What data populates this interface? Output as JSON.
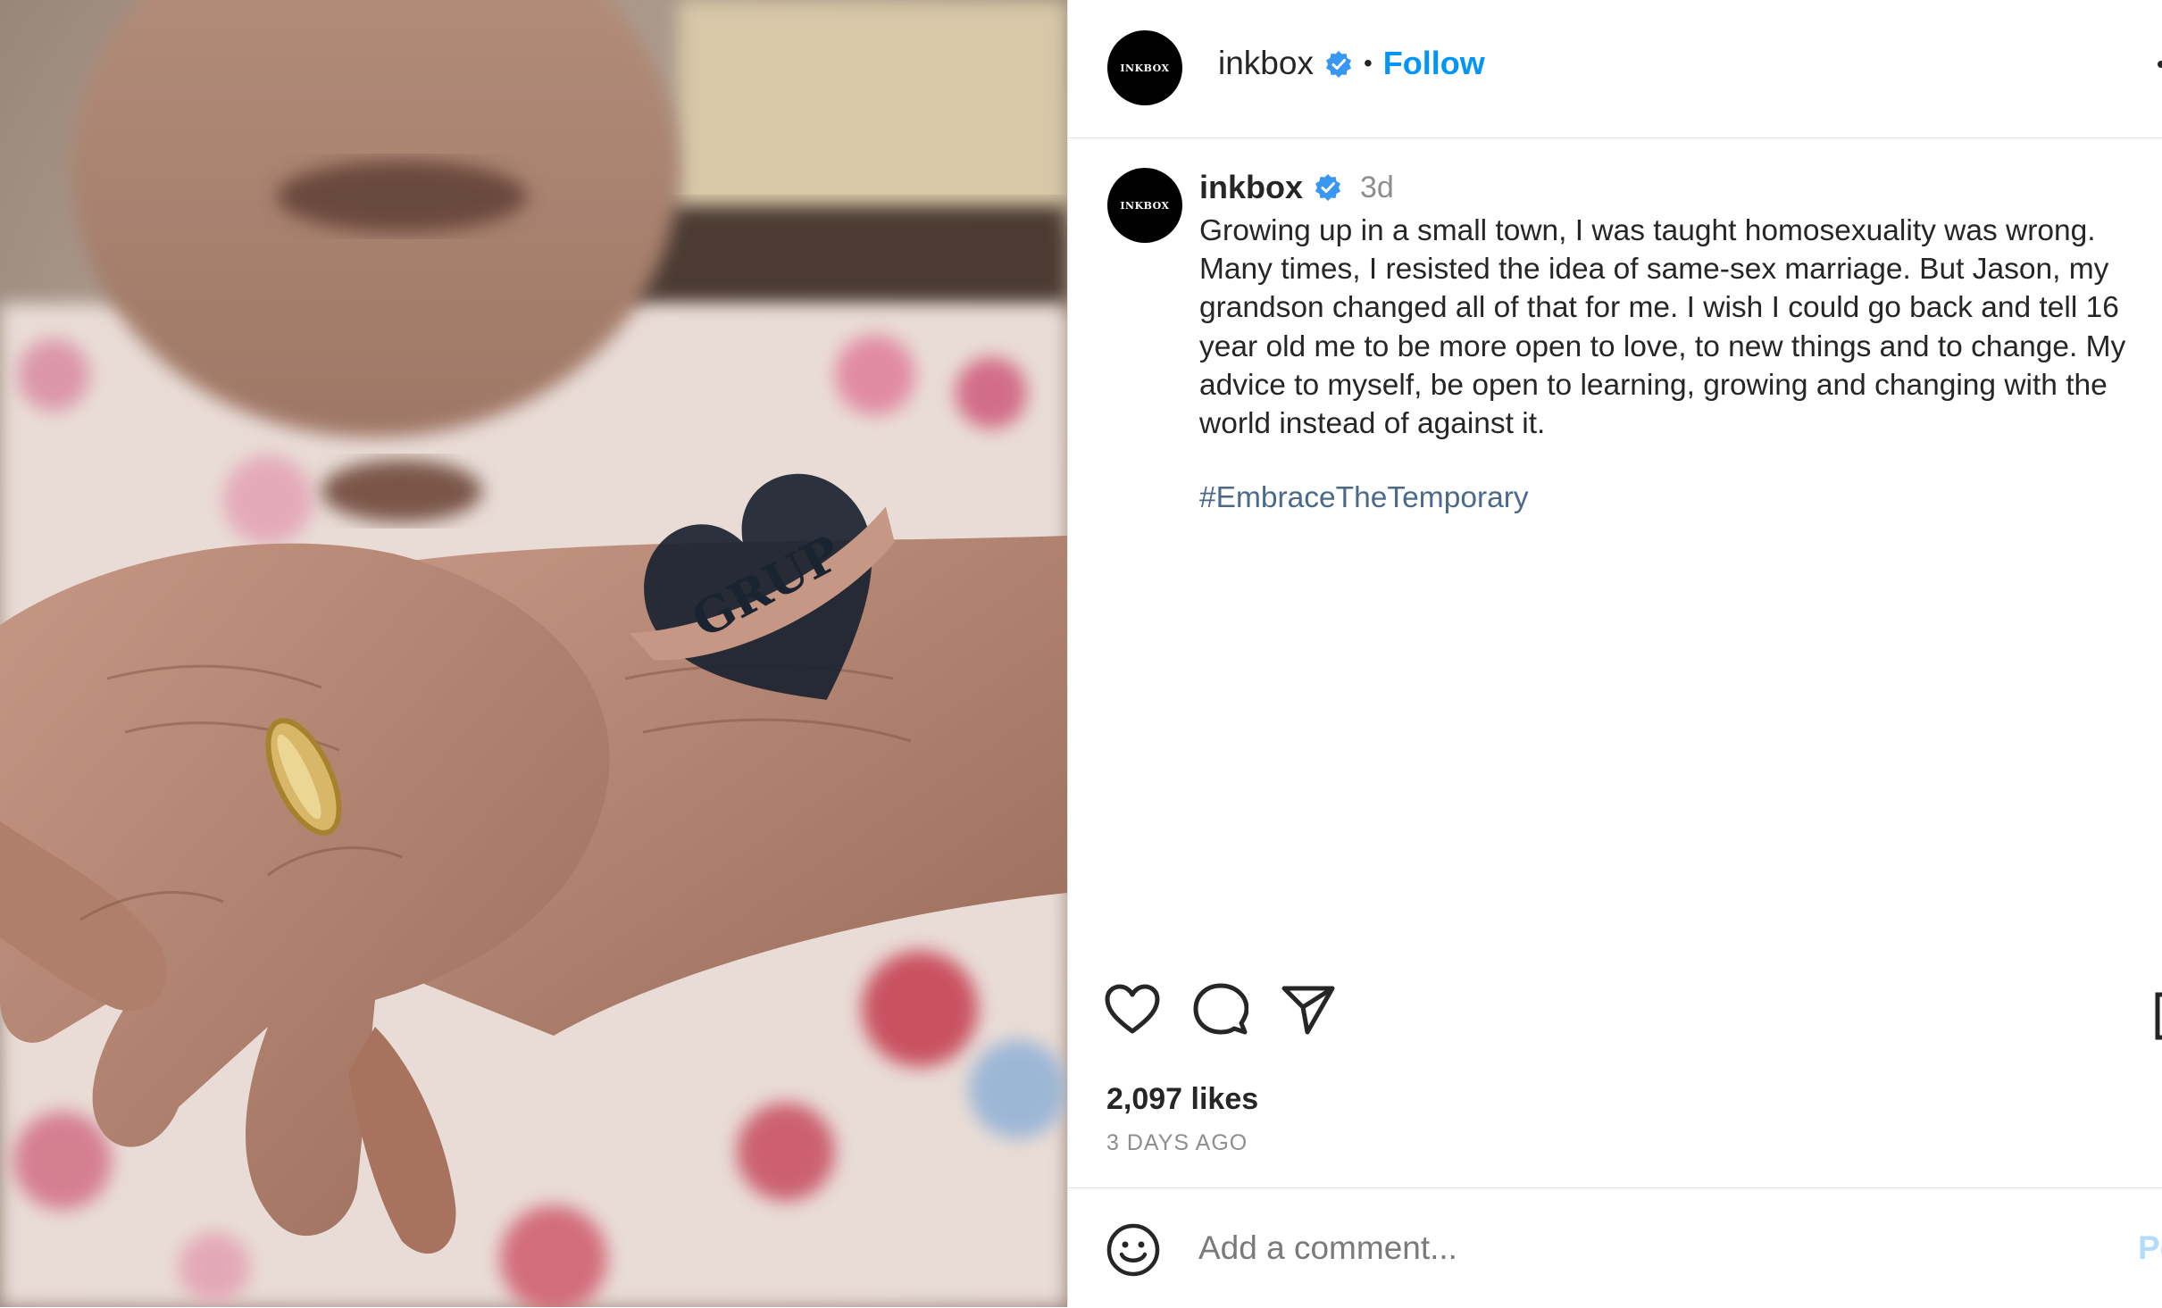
{
  "post": {
    "image_alt": "Elderly hands with heart tattoo",
    "tattoo_text": "GRUP"
  },
  "header": {
    "avatar_text": "INKBOX",
    "username": "inkbox",
    "separator": "•",
    "follow_label": "Follow"
  },
  "caption": {
    "avatar_text": "INKBOX",
    "username": "inkbox",
    "time": "3d",
    "text": "Growing up in a small town, I was taught homosexuality was wrong. Many times, I resisted the idea of same-sex marriage. But Jason, my grandson changed all of that for me. I wish I could go back and tell 16 year old me to be more open to love, to new things and to change. My advice to myself, be open to learning, growing and changing with the world instead of against it.",
    "hashtag": "#EmbraceTheTemporary"
  },
  "stats": {
    "likes": "2,097 likes",
    "date": "3 DAYS AGO"
  },
  "comment": {
    "placeholder": "Add a comment...",
    "post_label": "Post"
  },
  "colors": {
    "accent": "#0095f6",
    "hashtag": "#4b6a8a",
    "muted": "#8e8e8e",
    "verified": "#3897f0"
  },
  "icons": [
    "verified-icon",
    "heart-icon",
    "comment-icon",
    "share-icon",
    "save-icon",
    "emoji-icon",
    "more-icon"
  ]
}
